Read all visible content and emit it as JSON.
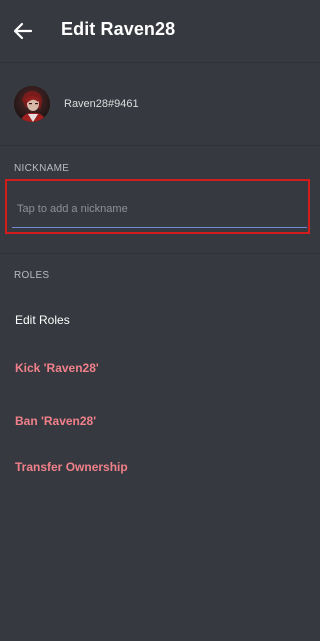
{
  "header": {
    "title": "Edit Raven28",
    "back_icon": "arrow-left-icon"
  },
  "profile": {
    "username": "Raven28#9461",
    "avatar_icon": "user-avatar"
  },
  "nickname": {
    "section_label": "NICKNAME",
    "placeholder": "Tap to add a nickname",
    "value": "",
    "highlight_color": "#d31c1c",
    "underline_color": "#7289da"
  },
  "roles": {
    "section_label": "ROLES",
    "edit_roles_label": "Edit Roles"
  },
  "actions": {
    "kick_label": "Kick 'Raven28'",
    "ban_label": "Ban 'Raven28'",
    "transfer_label": "Transfer Ownership",
    "danger_color": "#f0808a"
  },
  "colors": {
    "background": "#36393f",
    "divider": "#2f3136",
    "muted_text": "#b9bbbe"
  }
}
